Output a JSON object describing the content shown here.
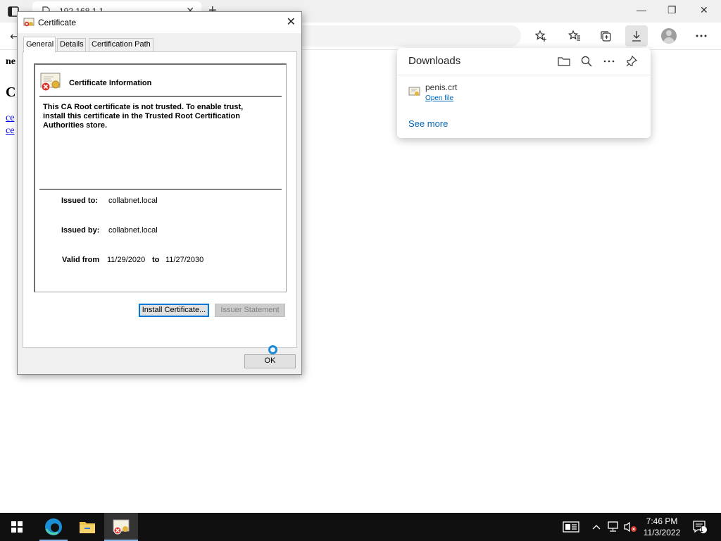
{
  "browser": {
    "tab_title": "192.168.1.1",
    "new_tab_glyph": "+",
    "close_tab_glyph": "✕",
    "window_controls": {
      "minimize": "—",
      "restore": "❐",
      "close": "✕"
    },
    "toolbar_icons": [
      "favorites-add-icon",
      "favorites-icon",
      "collections-icon",
      "downloads-icon",
      "profile-icon",
      "more-icon"
    ]
  },
  "page": {
    "bold_text": "ne",
    "heading": "C",
    "links": [
      "ce",
      "ce"
    ]
  },
  "downloads": {
    "title": "Downloads",
    "items": [
      {
        "name": "penis.crt",
        "action": "Open file"
      }
    ],
    "see_more": "See more",
    "header_icons": [
      "folder-icon",
      "search-icon",
      "more-icon",
      "pin-icon"
    ]
  },
  "dialog": {
    "title": "Certificate",
    "close_glyph": "✕",
    "tabs": [
      "General",
      "Details",
      "Certification Path"
    ],
    "active_tab": "General",
    "info_heading": "Certificate Information",
    "warning_lines": [
      "This CA Root certificate is not trusted. To enable trust,",
      "install this certificate in the Trusted Root Certification",
      "Authorities store."
    ],
    "issued_to_label": "Issued to:",
    "issued_to": "collabnet.local",
    "issued_by_label": "Issued by:",
    "issued_by": "collabnet.local",
    "valid_from_label": "Valid from",
    "valid_from": "11/29/2020",
    "to_label": "to",
    "valid_to": "11/27/2030",
    "install_button": "Install Certificate...",
    "issuer_statement_button": "Issuer Statement",
    "ok_button": "OK"
  },
  "taskbar": {
    "apps": [
      "start-icon",
      "edge-icon",
      "file-explorer-icon",
      "certificate-app-icon"
    ],
    "time": "7:46 PM",
    "date": "11/3/2022",
    "notification_count": "1"
  }
}
